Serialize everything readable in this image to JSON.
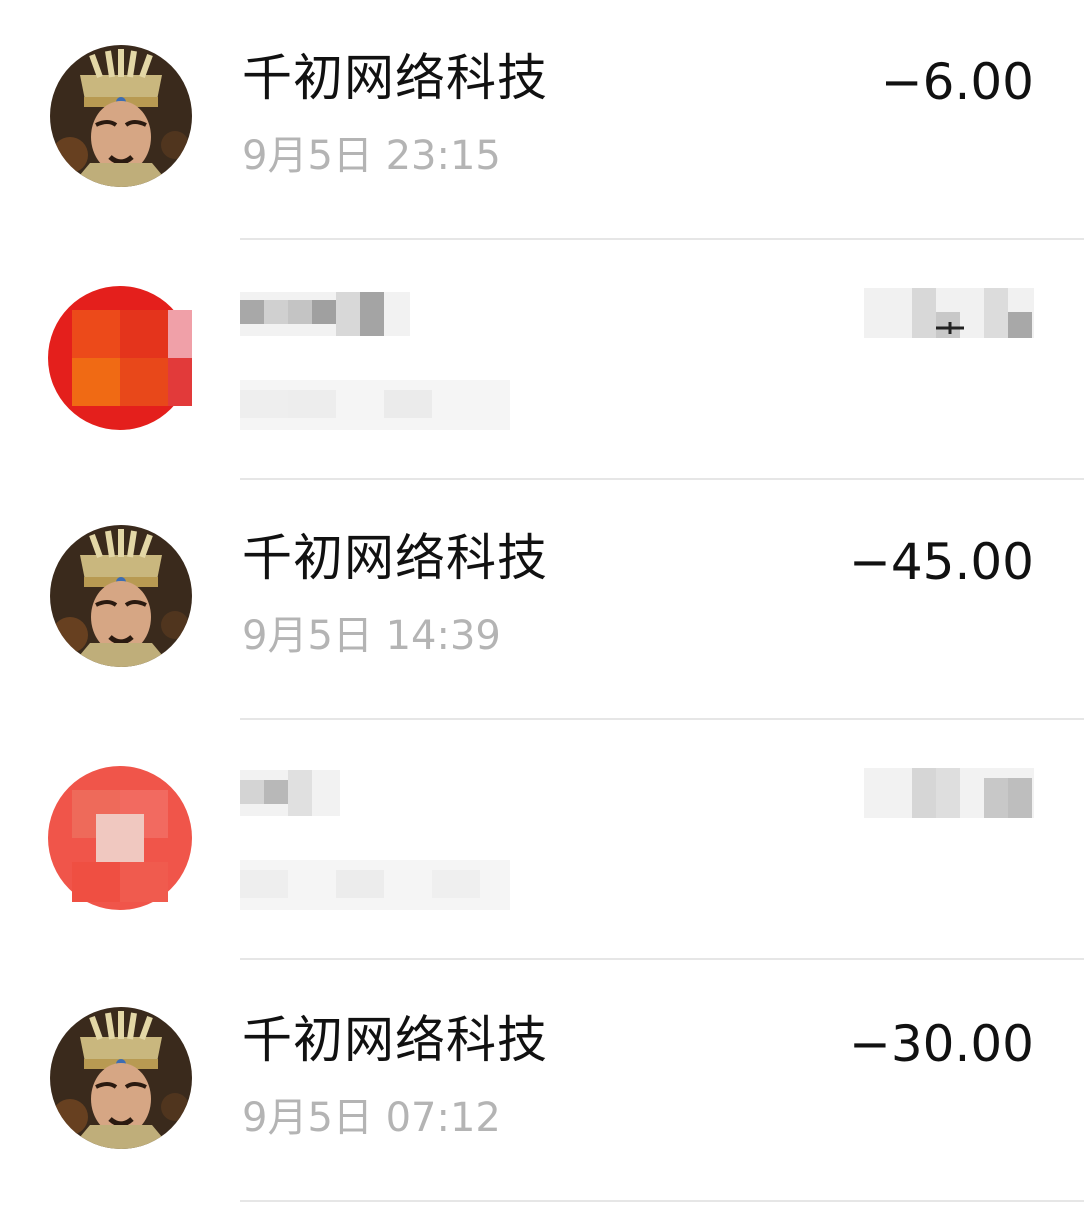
{
  "transactions": [
    {
      "title": "千初网络科技",
      "time": "9月5日 23:15",
      "amount": "−6.00",
      "avatar_icon": "game-character-avatar",
      "redacted": false
    },
    {
      "title": "",
      "time": "",
      "amount": "",
      "avatar_icon": "redacted-red-avatar",
      "redacted": true
    },
    {
      "title": "千初网络科技",
      "time": "9月5日 14:39",
      "amount": "−45.00",
      "avatar_icon": "game-character-avatar",
      "redacted": false
    },
    {
      "title": "",
      "time": "",
      "amount": "",
      "avatar_icon": "redacted-red-avatar",
      "redacted": true
    },
    {
      "title": "千初网络科技",
      "time": "9月5日 07:12",
      "amount": "−30.00",
      "avatar_icon": "game-character-avatar",
      "redacted": false
    }
  ],
  "colors": {
    "title": "#111111",
    "time": "#b4b4b4",
    "divider": "#e6e6e6",
    "redact_red": "#e53a2e"
  }
}
